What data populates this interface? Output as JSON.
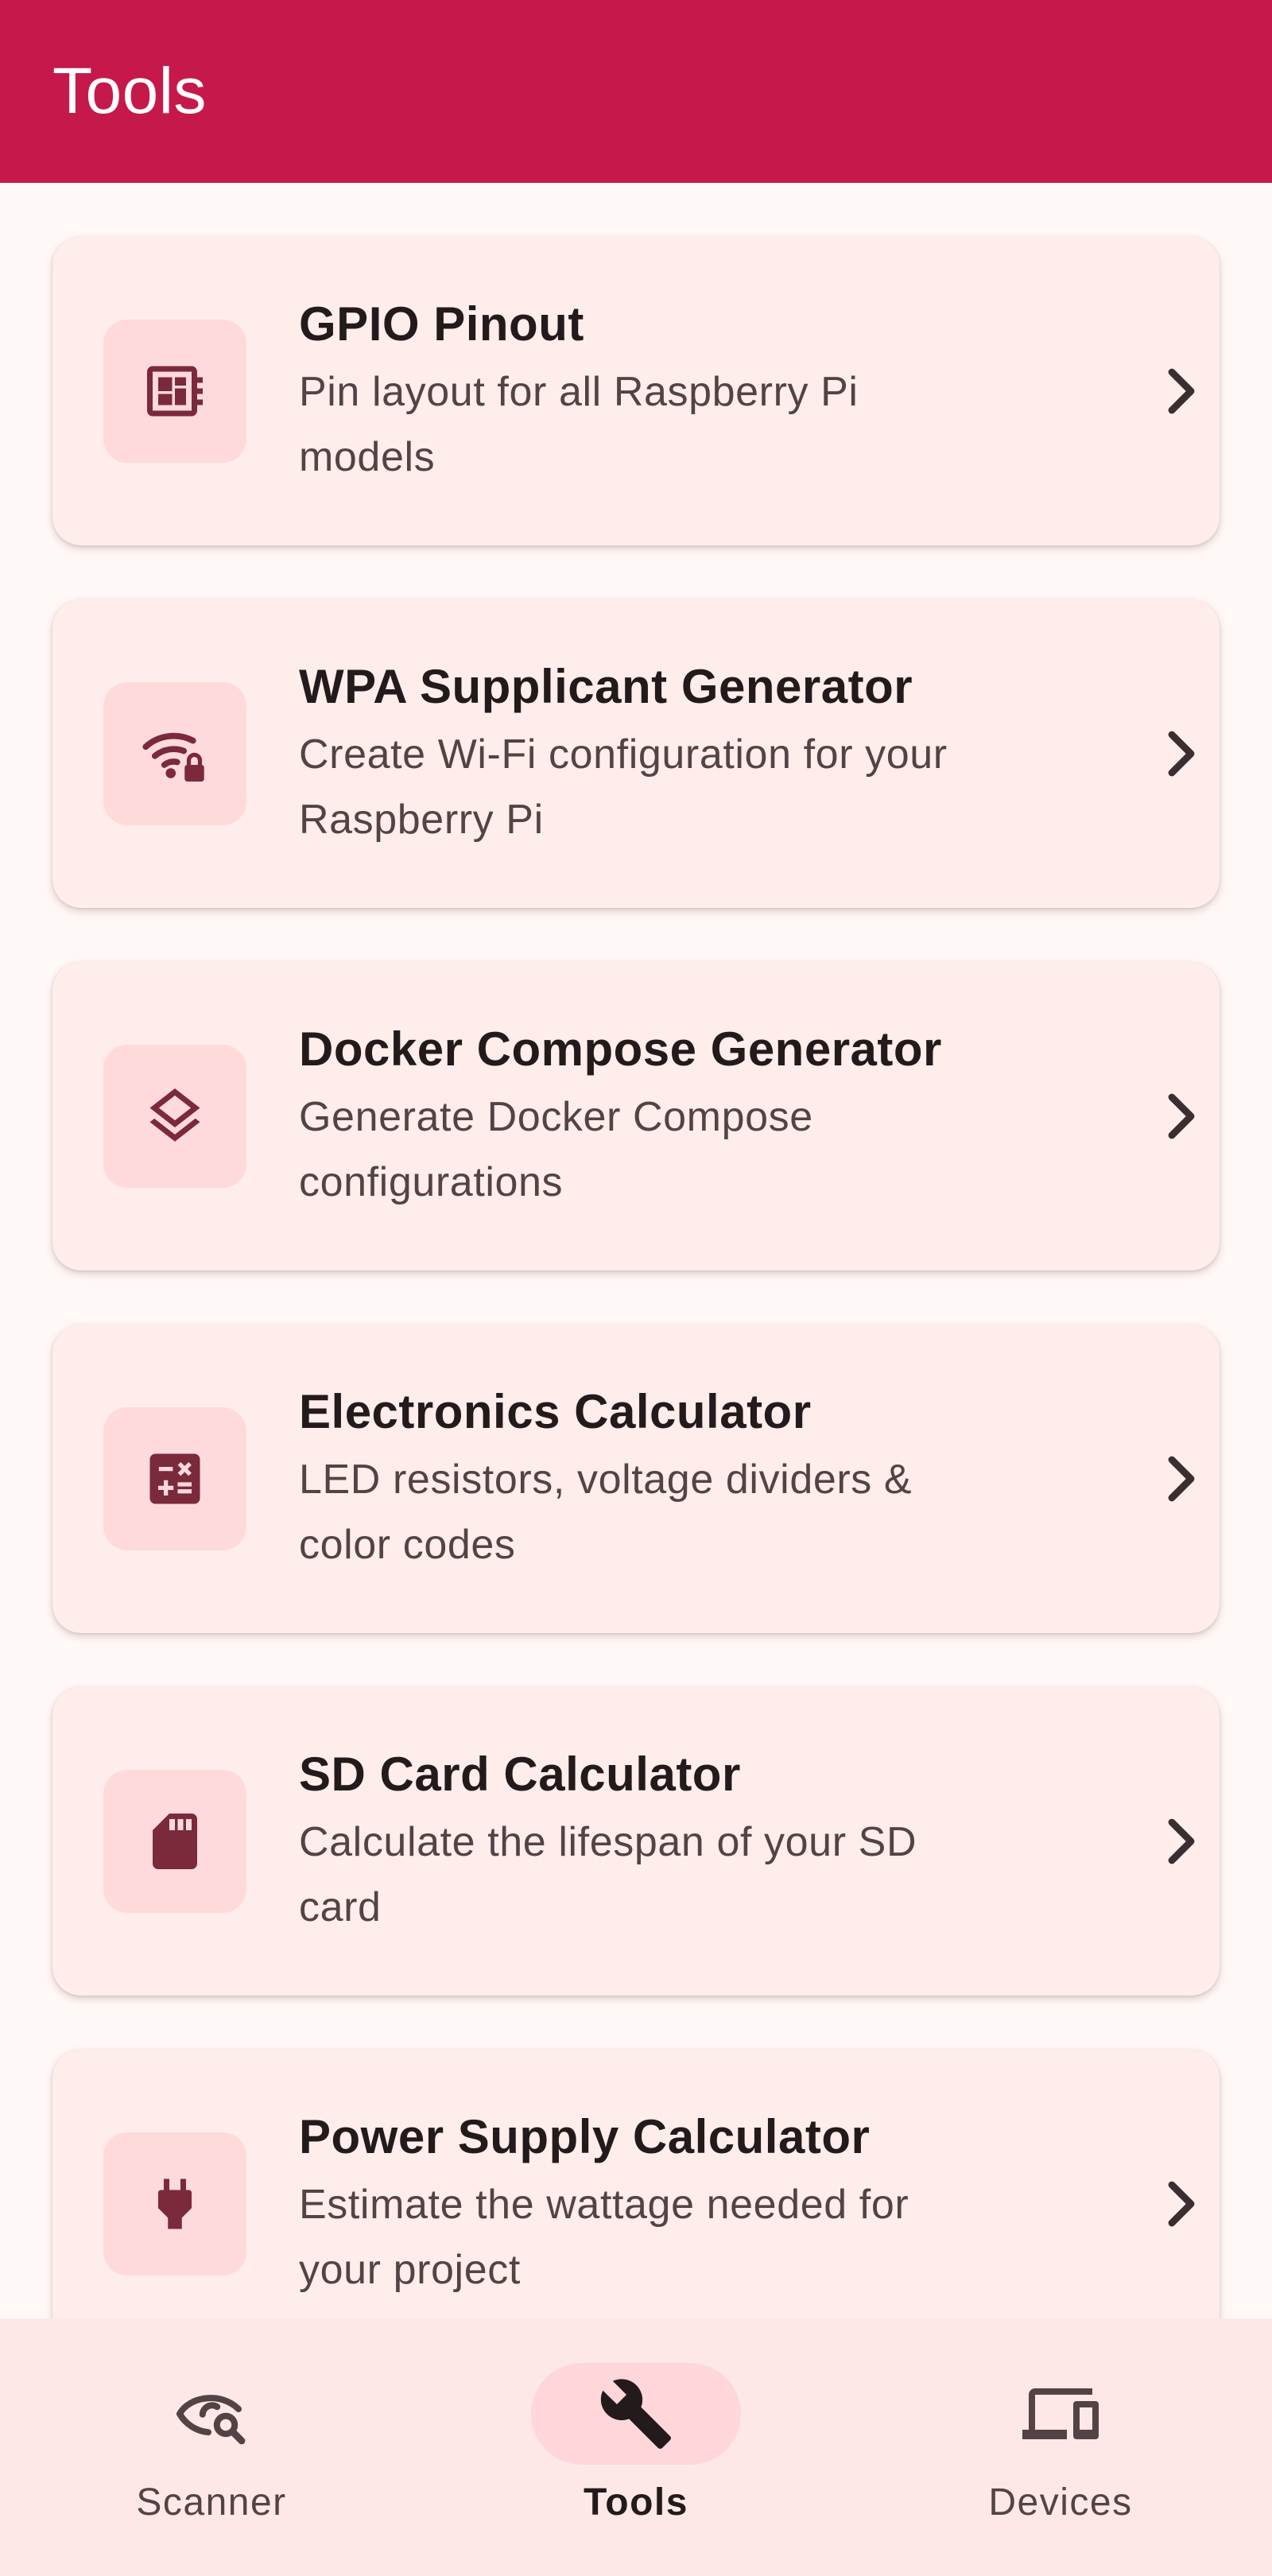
{
  "top_bar": {
    "title": "Tools"
  },
  "colors": {
    "primary": "#C6194B",
    "background": "#FFF8F6",
    "card": "#FFEDEC",
    "icon_tile": "#FFDADB",
    "icon": "#7A2A38",
    "nav_background": "#FDE8E7",
    "nav_active_indicator": "#FFD6DA"
  },
  "tools": [
    {
      "icon": "developer-board-icon",
      "title": "GPIO Pinout",
      "desc_1": "Pin layout for all Raspberry Pi",
      "desc_2": "models"
    },
    {
      "icon": "wifi-lock-icon",
      "title": "WPA Supplicant Generator",
      "desc_1": "Create Wi-Fi configuration for your",
      "desc_2": "Raspberry Pi"
    },
    {
      "icon": "layers-icon",
      "title": "Docker Compose Generator",
      "desc_1": "Generate Docker Compose",
      "desc_2": "configurations"
    },
    {
      "icon": "calculate-icon",
      "title": "Electronics Calculator",
      "desc_1": "LED resistors, voltage dividers &",
      "desc_2": "color codes"
    },
    {
      "icon": "sd-card-icon",
      "title": "SD Card Calculator",
      "desc_1": "Calculate the lifespan of your SD",
      "desc_2": "card"
    },
    {
      "icon": "power-plug-icon",
      "title": "Power Supply Calculator",
      "desc_1": "Estimate the wattage needed for",
      "desc_2": "your project"
    }
  ],
  "bottom_nav": {
    "active": "Tools",
    "items": [
      {
        "icon": "scanner-eye-icon",
        "label": "Scanner"
      },
      {
        "icon": "wrench-icon",
        "label": "Tools"
      },
      {
        "icon": "devices-icon",
        "label": "Devices"
      }
    ]
  }
}
